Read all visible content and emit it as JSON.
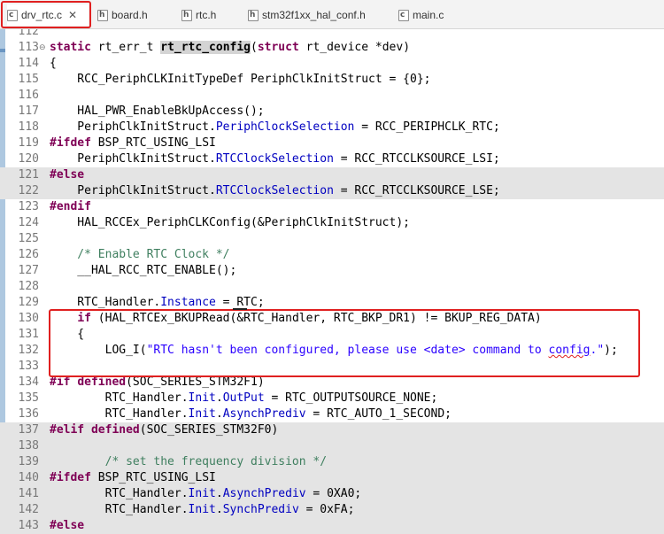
{
  "tabs": [
    {
      "icon": "c-source-file-icon",
      "icon_letter": "c",
      "label": "drv_rtc.c",
      "close": "✕",
      "active": true
    },
    {
      "icon": "header-file-icon",
      "icon_letter": "h",
      "label": "board.h"
    },
    {
      "icon": "header-file-icon",
      "icon_letter": "h",
      "label": "rtc.h"
    },
    {
      "icon": "header-file-icon",
      "icon_letter": "h",
      "label": "stm32f1xx_hal_conf.h"
    },
    {
      "icon": "c-source-file-icon",
      "icon_letter": "c",
      "label": "main.c"
    }
  ],
  "highlight_color": "#e02020",
  "colors": {
    "keyword": "#7f0055",
    "field": "#0000c0",
    "comment": "#3f7f5f",
    "string": "#2a00ff"
  },
  "editor": {
    "lines": [
      {
        "n": "112",
        "text": ""
      },
      {
        "n": "113",
        "fold": "⊖",
        "text": "static rt_err_t rt_rtc_config(struct rt_device *dev)"
      },
      {
        "n": "114",
        "text": "{"
      },
      {
        "n": "115",
        "text": "    RCC_PeriphCLKInitTypeDef PeriphClkInitStruct = {0};"
      },
      {
        "n": "116",
        "text": ""
      },
      {
        "n": "117",
        "text": "    HAL_PWR_EnableBkUpAccess();"
      },
      {
        "n": "118",
        "text": "    PeriphClkInitStruct.PeriphClockSelection = RCC_PERIPHCLK_RTC;"
      },
      {
        "n": "119",
        "text": "#ifdef BSP_RTC_USING_LSI"
      },
      {
        "n": "120",
        "text": "    PeriphClkInitStruct.RTCClockSelection = RCC_RTCCLKSOURCE_LSI;"
      },
      {
        "n": "121",
        "text": "#else",
        "grey": true
      },
      {
        "n": "122",
        "text": "    PeriphClkInitStruct.RTCClockSelection = RCC_RTCCLKSOURCE_LSE;",
        "grey": true
      },
      {
        "n": "123",
        "text": "#endif"
      },
      {
        "n": "124",
        "text": "    HAL_RCCEx_PeriphCLKConfig(&PeriphClkInitStruct);"
      },
      {
        "n": "125",
        "text": ""
      },
      {
        "n": "126",
        "text": "    /* Enable RTC Clock */"
      },
      {
        "n": "127",
        "text": "    __HAL_RCC_RTC_ENABLE();"
      },
      {
        "n": "128",
        "text": ""
      },
      {
        "n": "129",
        "text": "    RTC_Handler.Instance = RTC;"
      },
      {
        "n": "130",
        "text": "    if (HAL_RTCEx_BKUPRead(&RTC_Handler, RTC_BKP_DR1) != BKUP_REG_DATA)"
      },
      {
        "n": "131",
        "text": "    {"
      },
      {
        "n": "132",
        "text": "        LOG_I(\"RTC hasn't been configured, please use <date> command to config.\");"
      },
      {
        "n": "133",
        "text": ""
      },
      {
        "n": "134",
        "text": "#if defined(SOC_SERIES_STM32F1)"
      },
      {
        "n": "135",
        "text": "        RTC_Handler.Init.OutPut = RTC_OUTPUTSOURCE_NONE;"
      },
      {
        "n": "136",
        "text": "        RTC_Handler.Init.AsynchPrediv = RTC_AUTO_1_SECOND;"
      },
      {
        "n": "137",
        "text": "#elif defined(SOC_SERIES_STM32F0)",
        "grey": true
      },
      {
        "n": "138",
        "text": "",
        "grey": true
      },
      {
        "n": "139",
        "text": "        /* set the frequency division */",
        "grey": true
      },
      {
        "n": "140",
        "text": "#ifdef BSP_RTC_USING_LSI",
        "grey": true
      },
      {
        "n": "141",
        "text": "        RTC_Handler.Init.AsynchPrediv = 0XA0;",
        "grey": true
      },
      {
        "n": "142",
        "text": "        RTC_Handler.Init.SynchPrediv = 0xFA;",
        "grey": true
      },
      {
        "n": "143",
        "text": "#else",
        "grey": true
      }
    ]
  }
}
